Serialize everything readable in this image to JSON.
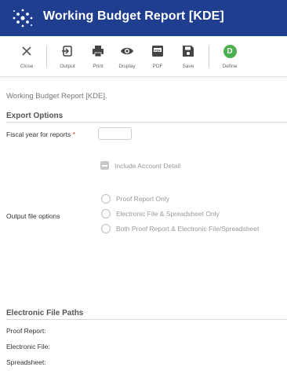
{
  "app": {
    "title": "Working Budget Report [KDE]"
  },
  "toolbar": {
    "close": "Close",
    "output": "Output",
    "print": "Print",
    "display": "Display",
    "pdf": "PDF",
    "save": "Save",
    "define": "Define",
    "define_badge": "D"
  },
  "breadcrumb": "Working Budget Report [KDE].",
  "export_options": {
    "heading": "Export Options",
    "fiscal_year_label": "Fiscal year for reports",
    "fiscal_year_required": "*",
    "fiscal_year_value": "",
    "include_detail_label": "Include Account Detail",
    "output_file_options_label": "Output file options",
    "radio_options": [
      "Proof Report Only",
      "Electronic File & Spreadsheet Only",
      "Both Proof Report & Electronic File/Spreadsheet"
    ]
  },
  "file_paths": {
    "heading": "Electronic File Paths",
    "proof_report": "Proof Report:",
    "electronic_file": "Electronic File:",
    "spreadsheet": "Spreadsheet:"
  },
  "colors": {
    "titlebar": "#1f3e8f",
    "define_badge": "#4caf50",
    "required": "#d32f2f"
  },
  "icons": [
    "app-logo-icon",
    "close-icon",
    "output-icon",
    "print-icon",
    "display-icon",
    "pdf-icon",
    "save-icon"
  ]
}
